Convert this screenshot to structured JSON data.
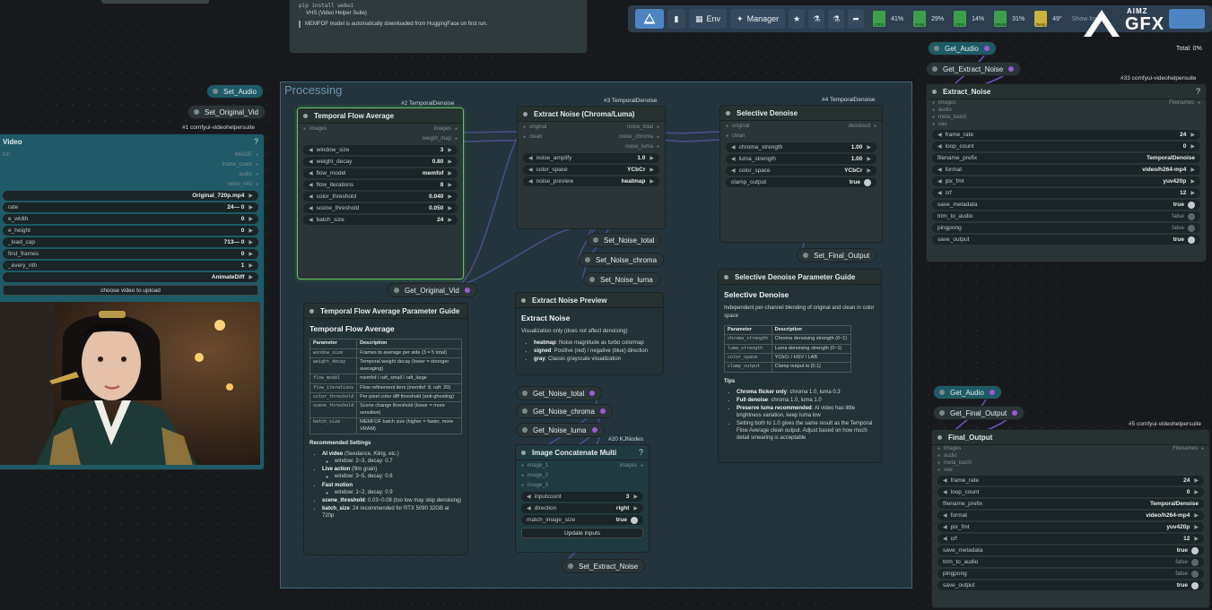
{
  "top_note": {
    "cmd": "pip install webui",
    "bullet": "VHS (Video Helper Suite)",
    "notice": "MEMFOF model is automatically downloaded from HuggingFace on first run."
  },
  "toolbar": {
    "env": "Env",
    "manager": "Manager",
    "stats": [
      {
        "pct": "41%",
        "label": "CPU"
      },
      {
        "pct": "29%",
        "label": "RAM"
      },
      {
        "pct": "14%",
        "label": "GPU"
      },
      {
        "pct": "31%",
        "label": "VRAM"
      },
      {
        "pct": "49°",
        "label": "Temp"
      }
    ],
    "show_image": "Show Im"
  },
  "logo": {
    "top": "AIMZ",
    "main": "GFX"
  },
  "total_label": "Total: 0%",
  "group": {
    "title": "Processing"
  },
  "reroutes": {
    "set_audio": "Set_Audio",
    "set_original_vid": "Set_Original_Vid",
    "get_original_vid": "Get_Original_Vid",
    "set_noise_total": "Set_Noise_total",
    "set_noise_chroma": "Set_Noise_chroma",
    "set_noise_luma": "Set_Noise_luma",
    "get_noise_total": "Get_Noise_total",
    "get_noise_chroma": "Get_Noise_chroma",
    "get_noise_luma": "Get_Noise_luma",
    "set_extract_noise": "Set_Extract_Noise",
    "set_final_output": "Set_Final_Output",
    "get_audio_top": "Get_Audio",
    "get_extract_noise": "Get_Extract_Noise",
    "get_audio_bottom": "Get_Audio",
    "get_final_output": "Get_Final_Output"
  },
  "load_video": {
    "tag": "#1 comfyui-videohelpersuite",
    "title": "Video",
    "outputs": [
      {
        "left": "tch",
        "right": "IMAGE"
      },
      {
        "left": "",
        "right": "frame_count"
      },
      {
        "left": "",
        "right": "audio"
      },
      {
        "left": "",
        "right": "video_info"
      }
    ],
    "widgets": [
      {
        "label": "",
        "value": "Original_720p.mp4"
      },
      {
        "label": "rate",
        "value": "24— 0"
      },
      {
        "label": "e_width",
        "value": "0"
      },
      {
        "label": "e_height",
        "value": "0"
      },
      {
        "label": "_load_cap",
        "value": "713— 0"
      },
      {
        "label": "first_frames",
        "value": "0"
      },
      {
        "label": "_every_nth",
        "value": "1"
      },
      {
        "label": "",
        "value": "AnimateDiff"
      }
    ],
    "upload": "choose video to upload"
  },
  "tfa": {
    "tag": "#2 TemporalDenoise",
    "title": "Temporal Flow Average",
    "in": "images",
    "outs": [
      "images",
      "weight_map"
    ],
    "widgets": [
      {
        "label": "window_size",
        "value": "3"
      },
      {
        "label": "weight_decay",
        "value": "0.80"
      },
      {
        "label": "flow_model",
        "value": "memfof"
      },
      {
        "label": "flow_iterations",
        "value": "8"
      },
      {
        "label": "color_threshold",
        "value": "0.040"
      },
      {
        "label": "scene_threshold",
        "value": "0.050"
      },
      {
        "label": "batch_size",
        "value": "24"
      }
    ]
  },
  "extract": {
    "tag": "#3 TemporalDenoise",
    "title": "Extract Noise (Chroma/Luma)",
    "ins": [
      "original",
      "clean"
    ],
    "outs": [
      "noise_total",
      "noise_chroma",
      "noise_luma"
    ],
    "widgets": [
      {
        "label": "noise_amplify",
        "value": "1.0"
      },
      {
        "label": "color_space",
        "value": "YCbCr"
      },
      {
        "label": "noise_preview",
        "value": "heatmap"
      }
    ]
  },
  "selective": {
    "tag": "#4 TemporalDenoise",
    "title": "Selective Denoise",
    "ins": [
      "original",
      "clean"
    ],
    "outs": [
      "denoised"
    ],
    "widgets": [
      {
        "label": "chroma_strength",
        "value": "1.00"
      },
      {
        "label": "luma_strength",
        "value": "1.00"
      },
      {
        "label": "color_space",
        "value": "YCbCr"
      },
      {
        "label": "clamp_output",
        "value": "true"
      }
    ]
  },
  "tfa_guide": {
    "title": "Temporal Flow Average Parameter Guide",
    "heading": "Temporal Flow Average",
    "columns": [
      "Parameter",
      "Description"
    ],
    "rows": [
      [
        "window_size",
        "Frames to average per side (3 = 5 total)"
      ],
      [
        "weight_decay",
        "Temporal weight decay (lower = stronger averaging)"
      ],
      [
        "flow_model",
        "memfof / raft_small / raft_large"
      ],
      [
        "flow_iterations",
        "Flow refinement iters (memfof: 8, raft: 20)"
      ],
      [
        "color_threshold",
        "Per-pixel color diff threshold (anti-ghosting)"
      ],
      [
        "scene_threshold",
        "Scene change threshold (lower = more sensitive)"
      ],
      [
        "batch_size",
        "MEMFOF batch size (higher = faster, more VRAM)"
      ]
    ],
    "rec_title": "Recommended Settings",
    "rec": [
      {
        "k": "AI video",
        "v": "(Seedance, Kling, etc.)",
        "sub": "window: 2~3, decay: 0.7"
      },
      {
        "k": "Live action",
        "v": "(film grain)",
        "sub": "window: 3~5, decay: 0.6"
      },
      {
        "k": "Fast motion",
        "v": "",
        "sub": "window: 1~2, decay: 0.9"
      },
      {
        "k": "scene_threshold",
        "v": ": 0.03~0.08 (too low may skip denoising)",
        "sub": ""
      },
      {
        "k": "batch_size",
        "v": ": 24 recommended for RTX 5090 32GB at 720p",
        "sub": ""
      }
    ]
  },
  "extract_preview": {
    "title": "Extract Noise Preview",
    "heading": "Extract Noise",
    "intro": "Visualization only (does not affect denoising)",
    "items": [
      {
        "k": "heatmap",
        "v": ": Noise magnitude as turbo colormap"
      },
      {
        "k": "signed",
        "v": ": Positive (red) / negative (blue) direction"
      },
      {
        "k": "gray",
        "v": ": Classic grayscale visualization"
      }
    ]
  },
  "sel_guide": {
    "title": "Selective Denoise Parameter Guide",
    "heading": "Selective Denoise",
    "intro": "Independent per-channel blending of original and clean in color space",
    "columns": [
      "Parameter",
      "Description"
    ],
    "rows": [
      [
        "chroma_strength",
        "Chroma denoising strength (0~1)"
      ],
      [
        "luma_strength",
        "Luma denoising strength (0~1)"
      ],
      [
        "color_space",
        "YCbCr / HSV / LAB"
      ],
      [
        "clamp_output",
        "Clamp output to [0,1]"
      ]
    ],
    "tips_title": "Tips",
    "tips": [
      {
        "k": "Chroma flicker only",
        "v": ": chroma 1.0, luma 0.3"
      },
      {
        "k": "Full denoise",
        "v": ": chroma 1.0, luma 1.0"
      },
      {
        "k": "Preserve luma recommended",
        "v": ": AI video has little brightness variation, keep luma low"
      },
      {
        "k": "",
        "v": "Setting both to 1.0 gives the same result as the Temporal Flow Average clean output. Adjust based on how much detail smearing is acceptable"
      }
    ]
  },
  "concat": {
    "tag": "#20 KJNodes",
    "title": "Image Concatenate Multi",
    "ins": [
      "image_1",
      "image_2",
      "image_3"
    ],
    "out": "images",
    "widgets": [
      {
        "label": "inputcount",
        "value": "3"
      },
      {
        "label": "direction",
        "value": "right"
      },
      {
        "label": "match_image_size",
        "value": "true"
      }
    ],
    "button": "Update inputs"
  },
  "combine_top": {
    "tag": "#33 comfyui-videohelpersuite",
    "title": "Extract_Noise",
    "ins": [
      "images",
      "audio",
      "meta_batch",
      "vae"
    ],
    "out": "Filenames",
    "widgets": [
      {
        "label": "frame_rate",
        "value": "24"
      },
      {
        "label": "loop_count",
        "value": "0"
      },
      {
        "label": "filename_prefix",
        "value": "TemporalDenoise"
      },
      {
        "label": "format",
        "value": "video/h264-mp4"
      },
      {
        "label": "pix_fmt",
        "value": "yuv420p"
      },
      {
        "label": "crf",
        "value": "12"
      },
      {
        "label": "save_metadata",
        "value": "true"
      },
      {
        "label": "trim_to_audio",
        "value": "false"
      },
      {
        "label": "pingpong",
        "value": "false"
      },
      {
        "label": "save_output",
        "value": "true"
      }
    ]
  },
  "combine_bottom": {
    "tag": "#5 comfyui-videohelpersuite",
    "title": "Final_Output",
    "ins": [
      "images",
      "audio",
      "meta_batch",
      "vae"
    ],
    "out": "Filenames",
    "widgets": [
      {
        "label": "frame_rate",
        "value": "24"
      },
      {
        "label": "loop_count",
        "value": "0"
      },
      {
        "label": "filename_prefix",
        "value": "TemporalDenoise"
      },
      {
        "label": "format",
        "value": "video/h264-mp4"
      },
      {
        "label": "pix_fmt",
        "value": "yuv420p"
      },
      {
        "label": "crf",
        "value": "12"
      },
      {
        "label": "save_metadata",
        "value": "true"
      },
      {
        "label": "trim_to_audio",
        "value": "false"
      },
      {
        "label": "pingpong",
        "value": "false"
      },
      {
        "label": "save_output",
        "value": "true"
      }
    ]
  },
  "colors": {
    "accent": "#4e84c4",
    "wire": "#7b55c9",
    "selected": "#6bbd6b",
    "group": "#2e4a5a"
  }
}
